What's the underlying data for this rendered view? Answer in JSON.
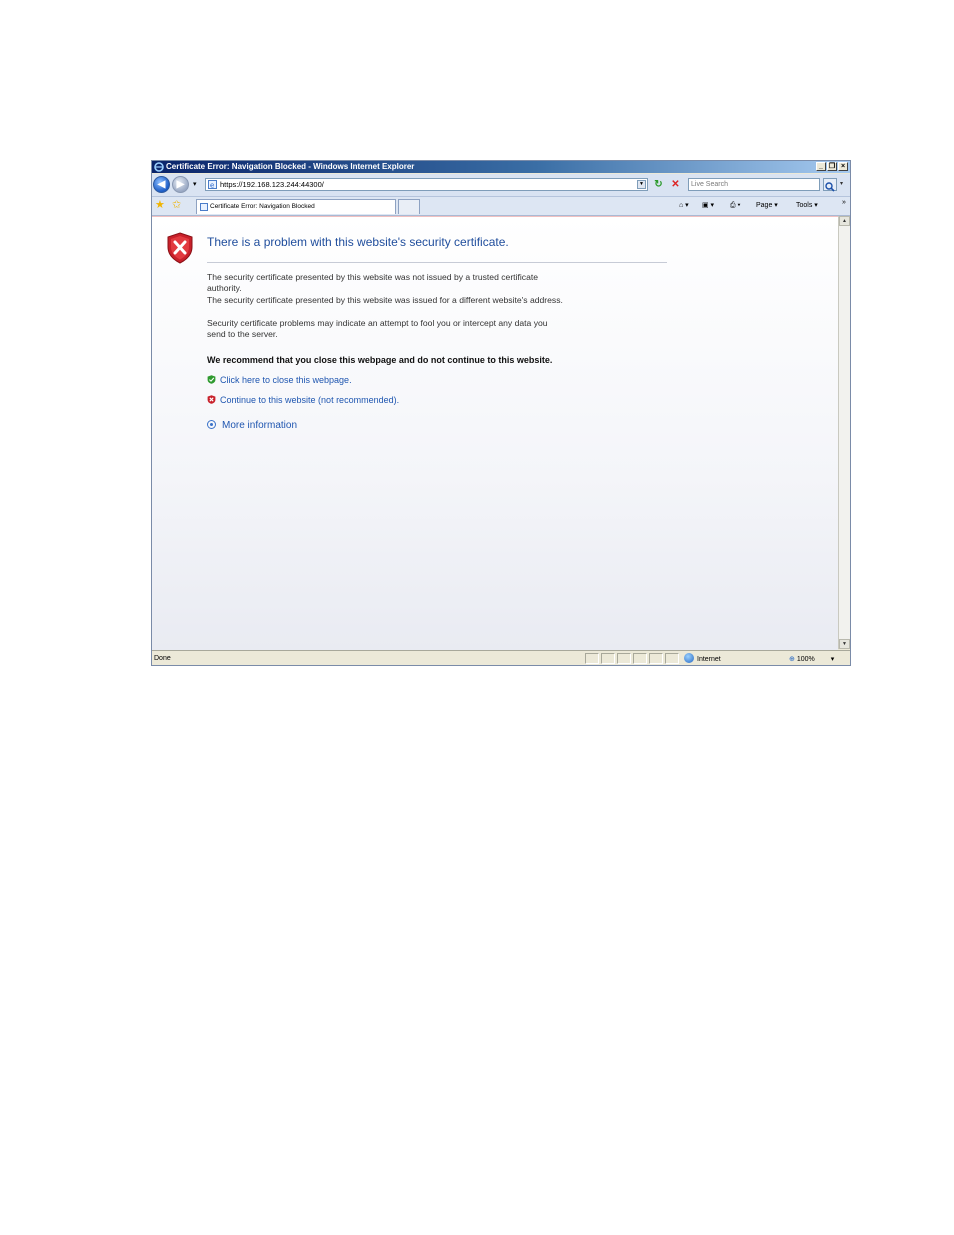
{
  "window": {
    "title": "Certificate Error: Navigation Blocked - Windows Internet Explorer",
    "controls": {
      "minimize": "_",
      "maximize": "❐",
      "close": "×"
    }
  },
  "navbar": {
    "back_icon": "back-arrow-icon",
    "forward_icon": "forward-arrow-icon",
    "dropdown": "▾",
    "url": "https://192.168.123.244:44300/",
    "refresh": "↻",
    "stop": "✕",
    "search_placeholder": "Live Search",
    "search_dropdown": "▾"
  },
  "tabbar": {
    "tab_label": "Certificate Error: Navigation Blocked",
    "commands": {
      "home": "⌂ ▾",
      "feeds": "▣ ▾",
      "print": "⎙ ▾",
      "page": "Page ▾",
      "tools": "Tools ▾",
      "more": "»"
    }
  },
  "content": {
    "heading": "There is a problem with this website's security certificate.",
    "para1_line1": "The security certificate presented by this website was not issued by a trusted certificate",
    "para1_line2": "authority.",
    "para2": "The security certificate presented by this website was issued for a different website's address.",
    "para3_line1": "Security certificate problems may indicate an attempt to fool you or intercept any data you",
    "para3_line2": "send to the server.",
    "recommendation": "We recommend that you close this webpage and do not continue to this website.",
    "close_link": "Click here to close this webpage.",
    "continue_link": "Continue to this website (not recommended).",
    "more_info": "More information"
  },
  "statusbar": {
    "status": "Done",
    "zone": "Internet",
    "zoom": "100%",
    "zoom_dropdown": "▾"
  },
  "colors": {
    "heading": "#1f4d9c",
    "link": "#1f56b0",
    "titlebar": "#0a246a",
    "shield_red": "#c8202a"
  }
}
